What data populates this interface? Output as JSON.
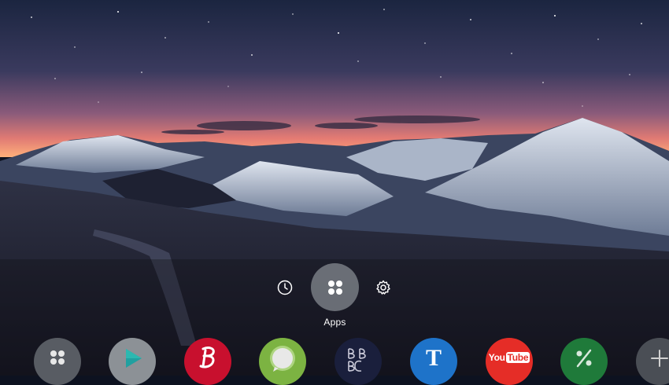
{
  "hub": {
    "recent_icon": "clock-icon",
    "apps_icon": "four-dots-icon",
    "apps_label": "Apps",
    "settings_icon": "gear-icon"
  },
  "dock": {
    "items": [
      {
        "name": "all-apps",
        "icon": "four-dots-icon",
        "color": "#585c63"
      },
      {
        "name": "play-store",
        "icon": "play-triangle-icon",
        "color": "#8c9196"
      },
      {
        "name": "budweiser",
        "icon": "b-logo-icon",
        "color": "#c8102e"
      },
      {
        "name": "chat",
        "icon": "speech-bubble-icon",
        "color": "#7cb342"
      },
      {
        "name": "bbc",
        "icon": "bbc-logo-icon",
        "color": "#1a1f3c"
      },
      {
        "name": "t-app",
        "letter": "T",
        "color": "#1e73c9"
      },
      {
        "name": "youtube",
        "label_you": "You",
        "label_tube": "Tube",
        "color": "#e52d27"
      },
      {
        "name": "percent-app",
        "icon": "percent-icon",
        "color": "#1f7a3a"
      },
      {
        "name": "add-app",
        "icon": "plus-icon",
        "color": "#4a4e55"
      }
    ]
  },
  "colors": {
    "sky_top": "#1b2540",
    "sunset_glow": "#ff8a6e",
    "snow": "#c9d1df",
    "foreground": "#1c1c27"
  }
}
